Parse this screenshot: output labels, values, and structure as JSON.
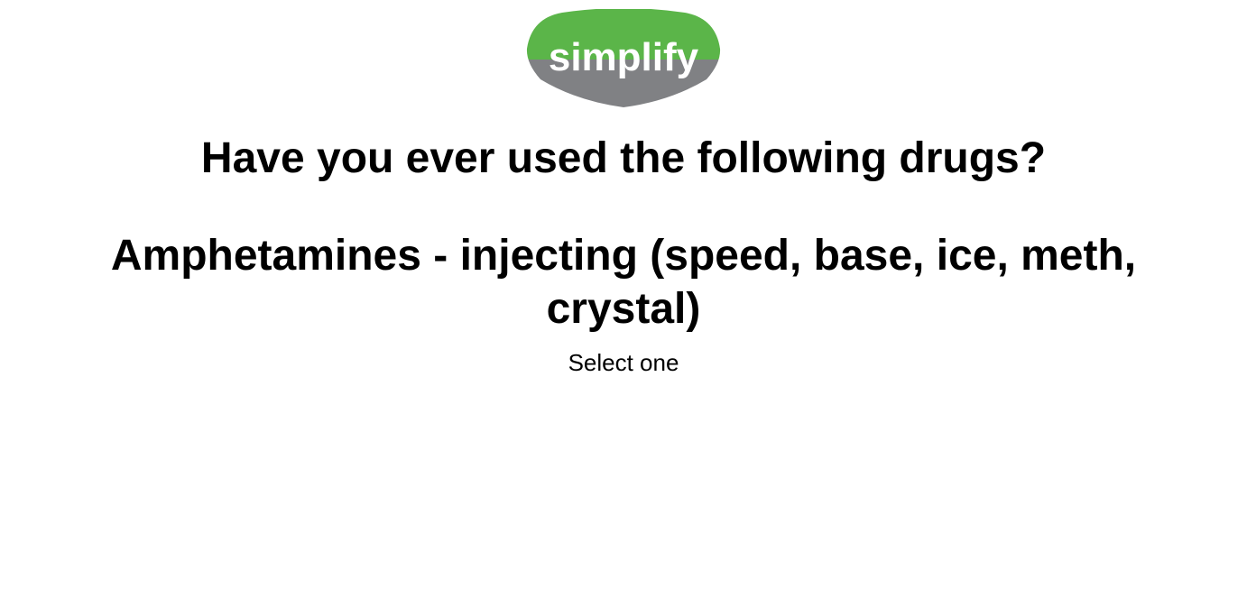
{
  "logo": {
    "text": "simplify",
    "colors": {
      "top": "#5bb549",
      "bottom": "#808184",
      "text": "#ffffff"
    }
  },
  "question": {
    "title": "Have you ever used the following drugs?",
    "item": "Amphetamines - injecting (speed, base, ice, meth, crystal)",
    "instruction": "Select one"
  }
}
